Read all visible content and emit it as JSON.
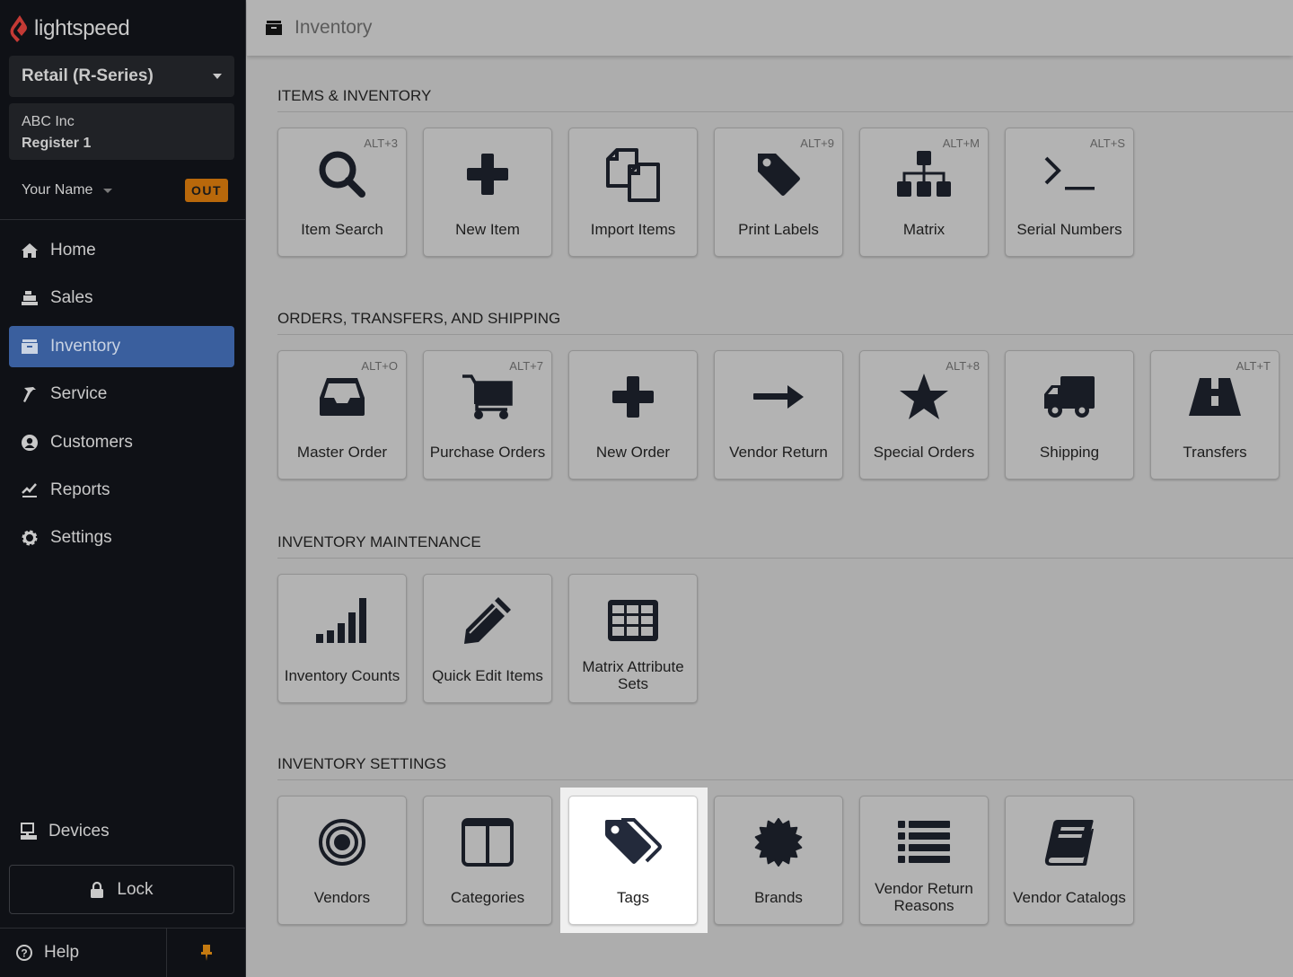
{
  "sidebar": {
    "logo_text": "lightspeed",
    "product": "Retail (R-Series)",
    "company": "ABC Inc",
    "register": "Register 1",
    "user_name": "Your Name",
    "clock_status": "OUT",
    "nav": [
      {
        "label": "Home",
        "icon": "home-icon",
        "active": false
      },
      {
        "label": "Sales",
        "icon": "cash-register-icon",
        "active": false
      },
      {
        "label": "Inventory",
        "icon": "archive-box-icon",
        "active": true
      },
      {
        "label": "Service",
        "icon": "hammer-icon",
        "active": false
      },
      {
        "label": "Customers",
        "icon": "user-circle-icon",
        "active": false
      },
      {
        "label": "Reports",
        "icon": "chart-line-icon",
        "active": false
      },
      {
        "label": "Settings",
        "icon": "gear-icon",
        "active": false
      }
    ],
    "devices": "Devices",
    "lock": "Lock",
    "help": "Help"
  },
  "colors": {
    "accent": "#3a5f9e",
    "out_badge": "#b8680b",
    "pin": "#c47a10",
    "logo": "#c43a35"
  },
  "header": {
    "title": "Inventory"
  },
  "sections": [
    {
      "title": "ITEMS & INVENTORY",
      "tiles": [
        {
          "label": "Item Search",
          "shortcut": "ALT+3",
          "icon": "search-icon"
        },
        {
          "label": "New Item",
          "shortcut": "",
          "icon": "plus-icon"
        },
        {
          "label": "Import Items",
          "shortcut": "",
          "icon": "files-icon"
        },
        {
          "label": "Print Labels",
          "shortcut": "ALT+9",
          "icon": "tag-icon"
        },
        {
          "label": "Matrix",
          "shortcut": "ALT+M",
          "icon": "sitemap-icon"
        },
        {
          "label": "Serial Numbers",
          "shortcut": "ALT+S",
          "icon": "terminal-icon"
        }
      ]
    },
    {
      "title": "ORDERS, TRANSFERS, AND SHIPPING",
      "tiles": [
        {
          "label": "Master Order",
          "shortcut": "ALT+O",
          "icon": "inbox-icon"
        },
        {
          "label": "Purchase Orders",
          "shortcut": "ALT+7",
          "icon": "cart-icon"
        },
        {
          "label": "New Order",
          "shortcut": "",
          "icon": "plus-icon"
        },
        {
          "label": "Vendor Return",
          "shortcut": "",
          "icon": "arrow-right-icon"
        },
        {
          "label": "Special Orders",
          "shortcut": "ALT+8",
          "icon": "star-icon"
        },
        {
          "label": "Shipping",
          "shortcut": "",
          "icon": "truck-icon"
        },
        {
          "label": "Transfers",
          "shortcut": "ALT+T",
          "icon": "road-icon"
        }
      ]
    },
    {
      "title": "INVENTORY MAINTENANCE",
      "tiles": [
        {
          "label": "Inventory Counts",
          "shortcut": "",
          "icon": "signal-bars-icon"
        },
        {
          "label": "Quick Edit Items",
          "shortcut": "",
          "icon": "pencil-icon"
        },
        {
          "label": "Matrix Attribute Sets",
          "shortcut": "",
          "icon": "table-grid-icon"
        }
      ]
    },
    {
      "title": "INVENTORY SETTINGS",
      "tiles": [
        {
          "label": "Vendors",
          "shortcut": "",
          "icon": "bullseye-icon"
        },
        {
          "label": "Categories",
          "shortcut": "",
          "icon": "columns-icon"
        },
        {
          "label": "Tags",
          "shortcut": "",
          "icon": "tags-icon",
          "highlighted": true
        },
        {
          "label": "Brands",
          "shortcut": "",
          "icon": "certificate-icon"
        },
        {
          "label": "Vendor Return Reasons",
          "shortcut": "",
          "icon": "list-icon"
        },
        {
          "label": "Vendor Catalogs",
          "shortcut": "",
          "icon": "book-icon"
        }
      ]
    }
  ]
}
